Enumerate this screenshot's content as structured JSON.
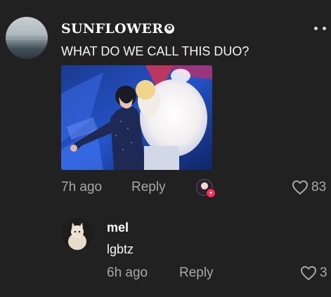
{
  "comments": [
    {
      "username": "SUNFLOWER",
      "badge_icon": "star-circle-icon",
      "text": "WHAT DO WE CALL THIS DUO?",
      "has_image": true,
      "time": "7h ago",
      "reply_label": "Reply",
      "creator_liked": true,
      "like_count": "83"
    },
    {
      "username": "mel",
      "text": "lgbtz",
      "time": "6h ago",
      "reply_label": "Reply",
      "like_count": "3"
    }
  ],
  "colors": {
    "background": "#212121",
    "text": "#ffffff",
    "muted": "#a8a8a8",
    "accent": "#fe2c55"
  }
}
